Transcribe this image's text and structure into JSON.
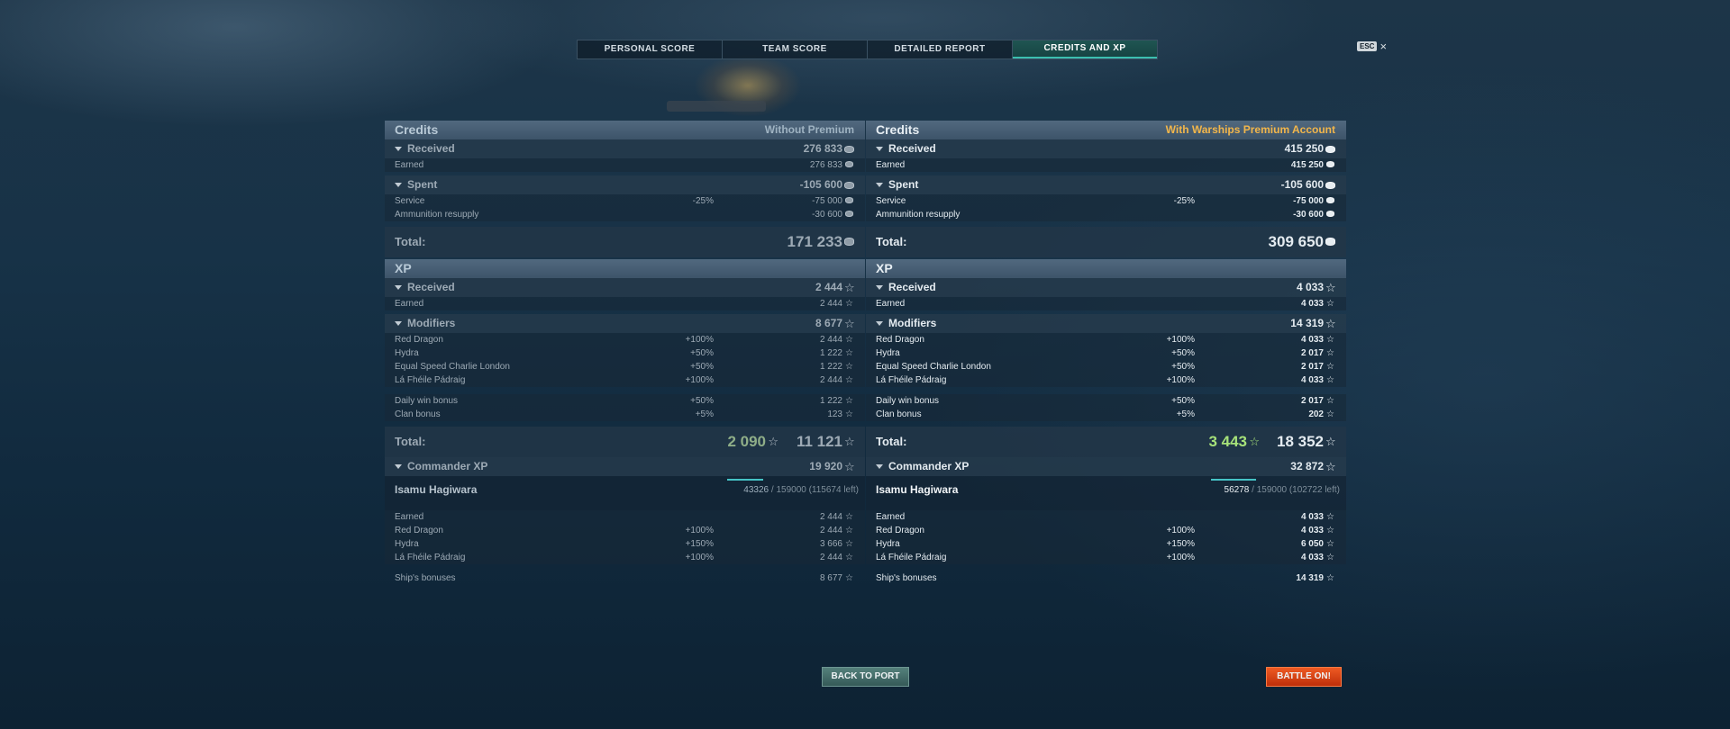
{
  "tabs": [
    "PERSONAL SCORE",
    "TEAM SCORE",
    "DETAILED REPORT",
    "CREDITS AND XP"
  ],
  "esc": {
    "key": "ESC",
    "close": "×"
  },
  "left": {
    "credits_title": "Credits",
    "credits_subtitle": "Without Premium",
    "received_label": "Received",
    "received_value": "276 833",
    "earned_label": "Earned",
    "earned_value": "276 833",
    "spent_label": "Spent",
    "spent_value": "-105 600",
    "service_label": "Service",
    "service_mod": "-25%",
    "service_value": "-75 000",
    "ammo_label": "Ammunition resupply",
    "ammo_value": "-30 600",
    "total_label": "Total:",
    "total_value": "171 233",
    "xp_title": "XP",
    "xp_received_label": "Received",
    "xp_received_value": "2 444",
    "xp_earned_label": "Earned",
    "xp_earned_value": "2 444",
    "modifiers_label": "Modifiers",
    "modifiers_value": "8 677",
    "mods": [
      {
        "label": "Red Dragon",
        "mod": "+100%",
        "value": "2 444"
      },
      {
        "label": "Hydra",
        "mod": "+50%",
        "value": "1 222"
      },
      {
        "label": "Equal Speed Charlie London",
        "mod": "+50%",
        "value": "1 222"
      },
      {
        "label": "Lá Fhéile Pádraig",
        "mod": "+100%",
        "value": "2 444"
      }
    ],
    "bonuses": [
      {
        "label": "Daily win bonus",
        "mod": "+50%",
        "value": "1 222"
      },
      {
        "label": "Clan bonus",
        "mod": "+5%",
        "value": "123"
      }
    ],
    "xp_total_label": "Total:",
    "xp_total_base": "2 090",
    "xp_total_value": "11 121",
    "cmd_label": "Commander XP",
    "cmd_value": "19 920",
    "commander_name": "Isamu Hagiwara",
    "cmd_progress_current": "43326",
    "cmd_progress_rest": "/ 159000 (115674 left)",
    "cmd_progress_fraction": 0.272,
    "cmd_earned_label": "Earned",
    "cmd_earned_value": "2 444",
    "cmd_mods": [
      {
        "label": "Red Dragon",
        "mod": "+100%",
        "value": "2 444"
      },
      {
        "label": "Hydra",
        "mod": "+150%",
        "value": "3 666"
      },
      {
        "label": "Lá Fhéile Pádraig",
        "mod": "+100%",
        "value": "2 444"
      }
    ],
    "ship_bonuses_label": "Ship's bonuses",
    "ship_bonuses_value": "8 677"
  },
  "right": {
    "credits_title": "Credits",
    "credits_subtitle": "With Warships Premium Account",
    "received_label": "Received",
    "received_value": "415 250",
    "earned_label": "Earned",
    "earned_value": "415 250",
    "spent_label": "Spent",
    "spent_value": "-105 600",
    "service_label": "Service",
    "service_mod": "-25%",
    "service_value": "-75 000",
    "ammo_label": "Ammunition resupply",
    "ammo_value": "-30 600",
    "total_label": "Total:",
    "total_value": "309 650",
    "xp_title": "XP",
    "xp_received_label": "Received",
    "xp_received_value": "4 033",
    "xp_earned_label": "Earned",
    "xp_earned_value": "4 033",
    "modifiers_label": "Modifiers",
    "modifiers_value": "14 319",
    "mods": [
      {
        "label": "Red Dragon",
        "mod": "+100%",
        "value": "4 033"
      },
      {
        "label": "Hydra",
        "mod": "+50%",
        "value": "2 017"
      },
      {
        "label": "Equal Speed Charlie London",
        "mod": "+50%",
        "value": "2 017"
      },
      {
        "label": "Lá Fhéile Pádraig",
        "mod": "+100%",
        "value": "4 033"
      }
    ],
    "bonuses": [
      {
        "label": "Daily win bonus",
        "mod": "+50%",
        "value": "2 017"
      },
      {
        "label": "Clan bonus",
        "mod": "+5%",
        "value": "202"
      }
    ],
    "xp_total_label": "Total:",
    "xp_total_base": "3 443",
    "xp_total_value": "18 352",
    "cmd_label": "Commander XP",
    "cmd_value": "32 872",
    "commander_name": "Isamu Hagiwara",
    "cmd_progress_current": "56278",
    "cmd_progress_rest": "/ 159000 (102722 left)",
    "cmd_progress_fraction": 0.354,
    "cmd_earned_label": "Earned",
    "cmd_earned_value": "4 033",
    "cmd_mods": [
      {
        "label": "Red Dragon",
        "mod": "+100%",
        "value": "4 033"
      },
      {
        "label": "Hydra",
        "mod": "+150%",
        "value": "6 050"
      },
      {
        "label": "Lá Fhéile Pádraig",
        "mod": "+100%",
        "value": "4 033"
      }
    ],
    "ship_bonuses_label": "Ship's bonuses",
    "ship_bonuses_value": "14 319"
  },
  "buttons": {
    "back": "BACK TO PORT",
    "battle": "BATTLE ON!"
  }
}
